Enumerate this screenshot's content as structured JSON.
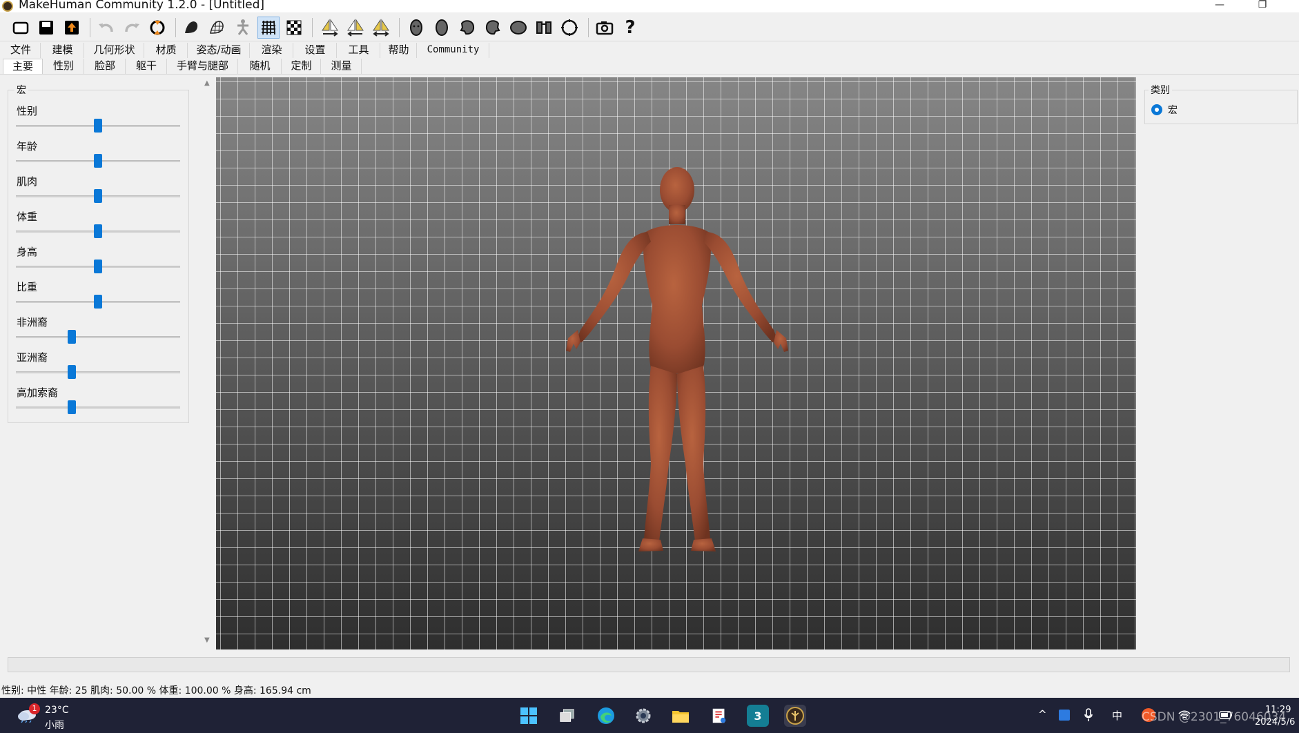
{
  "window": {
    "title": "MakeHuman Community 1.2.0 - [Untitled]",
    "minimize": "—",
    "restore": "❐"
  },
  "toolbar": {
    "icons": [
      "new-file-icon",
      "save-icon",
      "export-icon",
      "undo-icon",
      "redo-icon",
      "reset-icon",
      "smooth-icon",
      "wireframe-icon",
      "pose-icon",
      "grid-icon",
      "checker-icon",
      "symmetry-right-icon",
      "symmetry-left-icon",
      "symmetry-icon",
      "front-view-icon",
      "back-view-icon",
      "left-view-icon",
      "right-view-icon",
      "top-view-icon",
      "bottom-view-icon",
      "reset-camera-icon",
      "screenshot-icon",
      "help-icon"
    ],
    "help_label": "?"
  },
  "menus": [
    "文件",
    "建模",
    "几何形状",
    "材质",
    "姿态/动画",
    "渲染",
    "设置",
    "工具",
    "帮助",
    "Community"
  ],
  "tabs": [
    "主要",
    "性别",
    "脸部",
    "躯干",
    "手臂与腿部",
    "随机",
    "定制",
    "测量"
  ],
  "macro_panel": {
    "title": "宏",
    "sliders": [
      {
        "label": "性别",
        "value": 0.5
      },
      {
        "label": "年龄",
        "value": 0.5
      },
      {
        "label": "肌肉",
        "value": 0.5
      },
      {
        "label": "体重",
        "value": 0.5
      },
      {
        "label": "身高",
        "value": 0.5
      },
      {
        "label": "比重",
        "value": 0.5
      },
      {
        "label": "非洲裔",
        "value": 0.333
      },
      {
        "label": "亚洲裔",
        "value": 0.333
      },
      {
        "label": "高加索裔",
        "value": 0.333
      }
    ]
  },
  "category_panel": {
    "title": "类别",
    "option": "宏"
  },
  "scroll": {
    "up": "▲",
    "down": "▼"
  },
  "status": "性别: 中性  年龄: 25  肌肉: 50.00 %  体重: 100.00 %  身高: 165.94 cm",
  "taskbar": {
    "weather_badge": "1",
    "weather_temp": "23°C",
    "weather_desc": "小雨",
    "apps": [
      {
        "name": "windows-start-icon",
        "glyph": ""
      },
      {
        "name": "task-view-icon",
        "glyph": ""
      },
      {
        "name": "edge-browser-icon",
        "glyph": ""
      },
      {
        "name": "settings-gear-icon",
        "glyph": ""
      },
      {
        "name": "file-explorer-icon",
        "glyph": ""
      },
      {
        "name": "snipping-tool-icon",
        "glyph": ""
      },
      {
        "name": "3dsmax-icon",
        "glyph": "3"
      },
      {
        "name": "makehuman-icon",
        "glyph": ""
      }
    ],
    "tray": {
      "chevron": "^",
      "ime": "中",
      "watermark": "CSDN @2301_76046034",
      "time": "11:29",
      "date": "2024/5/6"
    }
  },
  "colors": {
    "accent": "#0a78d7",
    "skin": "#9e4f33",
    "taskbar": "#1f2236"
  }
}
